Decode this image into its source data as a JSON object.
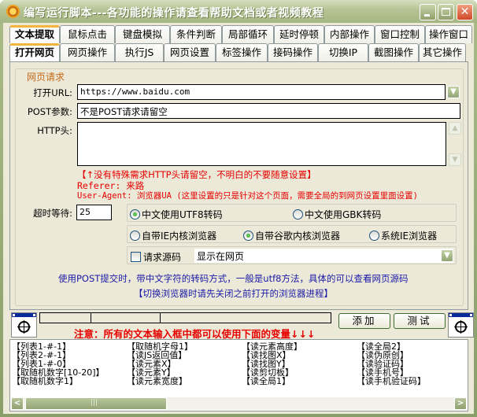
{
  "window": {
    "title": "编写运行脚本---各功能的操作请查看帮助文档或者视频教程",
    "minimize_label": "",
    "maximize_label": "",
    "close_label": "✕"
  },
  "tabs_row1": [
    "文本提取",
    "鼠标点击",
    "键盘模拟",
    "条件判断",
    "局部循环",
    "延时停顿",
    "内部操作",
    "窗口控制",
    "操作窗口"
  ],
  "tabs_row2": [
    "打开网页",
    "网页操作",
    "执行JS",
    "网页设置",
    "标签操作",
    "接码操作",
    "切换IP",
    "截图操作",
    "其它操作"
  ],
  "active_tab_row1": "文本提取",
  "active_tab_row2": "打开网页",
  "group": {
    "title": "网页请求",
    "url_label": "打开URL:",
    "url_value": "https://www.baidu.com",
    "post_label": "POST参数:",
    "post_value": "不是POST请求请留空",
    "http_label": "HTTP头:",
    "http_value": "",
    "notes": {
      "line1": "【↑没有特殊需求HTTP头请留空，不明白的不要随意设置】",
      "line2": "Referer: 来路",
      "line3": "User-Agent: 浏览器UA (这里设置的只是针对这个页面，需要全局的到网页设置里面设置)"
    },
    "timeout_label": "超时等待:",
    "timeout_value": "25",
    "encoding_options": [
      {
        "label": "中文使用UTF8转码",
        "selected": true
      },
      {
        "label": "中文使用GBK转码",
        "selected": false
      }
    ],
    "browser_options": [
      {
        "label": "自带IE内核浏览器",
        "selected": false
      },
      {
        "label": "自带谷歌内核浏览器",
        "selected": true
      },
      {
        "label": "系统IE浏览器",
        "selected": false
      }
    ],
    "request_source_label": "请求源码",
    "request_source_checked": false,
    "display_select_value": "显示在网页",
    "info_line1": "使用POST提交时，带中文字符的转码方式，一般是utf8方法，具体的可以查看网页源码",
    "info_line2": "【切换浏览器时请先关闭之前打开的浏览器进程】"
  },
  "bottom": {
    "warning": "注意：所有的文本输入框中都可以使用下面的变量↓↓↓",
    "add_button": "添加",
    "test_button": "测试"
  },
  "variables": [
    "【列表1-#-1】",
    "【取随机字母1】",
    "【读元素高度】",
    "【读全局2】",
    "【列表2-#-1】",
    "【读JS返回值】",
    "【读找图X】",
    "【读伪原创】",
    "【列表1-#-0】",
    "【读元素X】",
    "【读找图Y】",
    "【读验证码】",
    "【取随机数字[10-20]】",
    "【读元素Y】",
    "【读剪切板】",
    "【读手机号】",
    "【取随机数字1】",
    "【读元素宽度】",
    "【读全局1】",
    "【读手机验证码】"
  ],
  "scroll_fraction": 0.0
}
